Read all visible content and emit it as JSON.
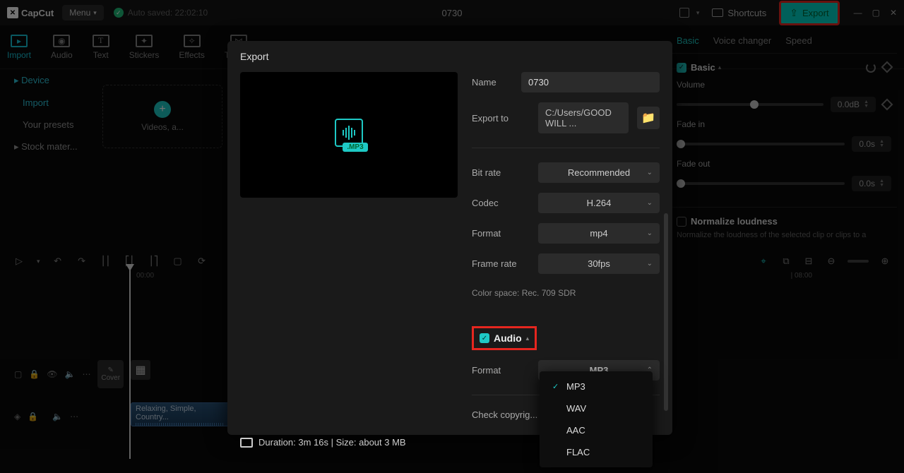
{
  "titlebar": {
    "app": "CapCut",
    "menu": "Menu",
    "autosave": "Auto saved: 22:02:10",
    "project": "0730",
    "shortcuts": "Shortcuts",
    "export": "Export"
  },
  "tabs": {
    "import": "Import",
    "audio": "Audio",
    "text": "Text",
    "stickers": "Stickers",
    "effects": "Effects",
    "transitions": "Trans..."
  },
  "sidebar": {
    "device": "Device",
    "import": "Import",
    "presets": "Your presets",
    "stock": "Stock mater..."
  },
  "drop": {
    "label": "Videos, a..."
  },
  "inspector": {
    "tabs": {
      "basic": "Basic",
      "voice": "Voice changer",
      "speed": "Speed"
    },
    "section": "Basic",
    "volume": {
      "label": "Volume",
      "value": "0.0dB"
    },
    "fadein": {
      "label": "Fade in",
      "value": "0.0s"
    },
    "fadeout": {
      "label": "Fade out",
      "value": "0.0s"
    },
    "normalize": {
      "label": "Normalize loudness",
      "desc": "Normalize the loudness of the selected clip or clips to a"
    }
  },
  "timeline": {
    "ruler0": "00:00",
    "ruler8": "| 08:00",
    "cover": "Cover",
    "clip": "Relaxing, Simple, Country..."
  },
  "modal": {
    "title": "Export",
    "mp3tag": ".MP3",
    "name": {
      "label": "Name",
      "value": "0730"
    },
    "exportto": {
      "label": "Export to",
      "value": "C:/Users/GOOD WILL ..."
    },
    "bitrate": {
      "label": "Bit rate",
      "value": "Recommended"
    },
    "codec": {
      "label": "Codec",
      "value": "H.264"
    },
    "format": {
      "label": "Format",
      "value": "mp4"
    },
    "framerate": {
      "label": "Frame rate",
      "value": "30fps"
    },
    "colorspace": "Color space: Rec. 709 SDR",
    "audio": "Audio",
    "aformat": {
      "label": "Format",
      "value": "MP3"
    },
    "copyright": "Check copyrig...",
    "duration": "Duration: 3m 16s | Size: about 3 MB",
    "options": {
      "mp3": "MP3",
      "wav": "WAV",
      "aac": "AAC",
      "flac": "FLAC"
    }
  }
}
